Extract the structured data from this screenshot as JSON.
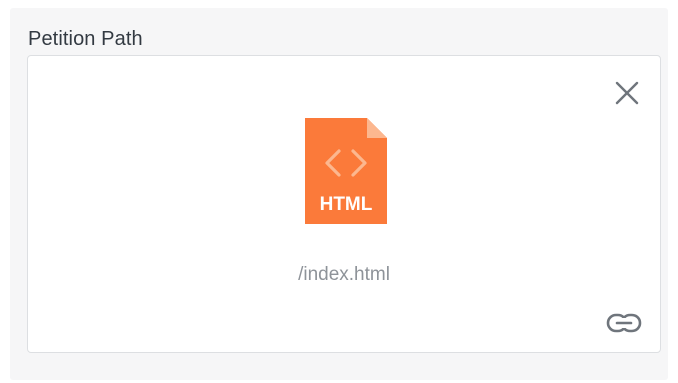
{
  "field": {
    "label": "Petition Path"
  },
  "file": {
    "name": "/index.html",
    "type_label": "HTML",
    "icon": "html-file-icon",
    "icon_color": "#fb7a3a",
    "icon_fold_color": "#fcb78f"
  },
  "actions": {
    "remove_icon": "close-icon",
    "link_icon": "link-icon"
  }
}
